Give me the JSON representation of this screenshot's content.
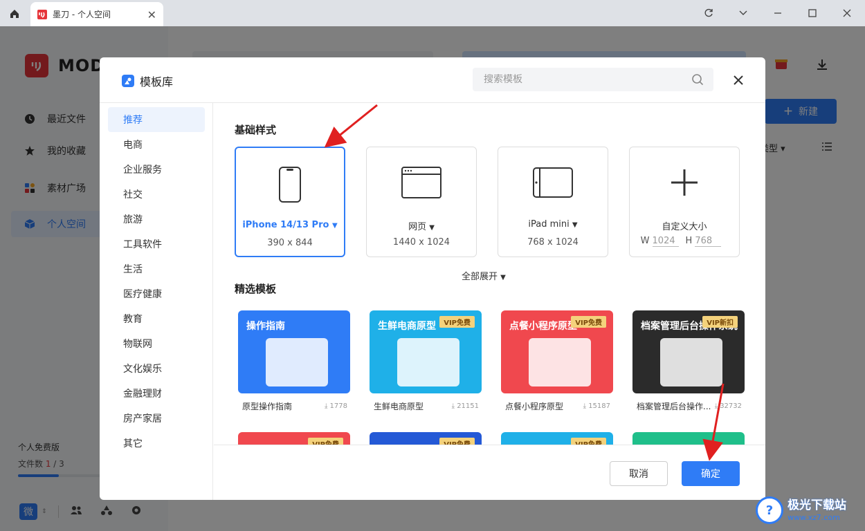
{
  "browser": {
    "tab_title": "墨刀 - 个人空间",
    "tab_close": "✕"
  },
  "sidebar": {
    "logo_text": "MOD",
    "items": [
      {
        "label": "最近文件",
        "icon": "clock-icon"
      },
      {
        "label": "我的收藏",
        "icon": "star-icon"
      },
      {
        "label": "素材广场",
        "icon": "shapes-icon"
      },
      {
        "label": "个人空间",
        "icon": "cube-icon"
      }
    ],
    "plan_label": "个人免费版",
    "file_count_label": "文件数",
    "file_count_value": "1",
    "file_count_total": " / 3",
    "file_usage_fraction": 0.33,
    "account_short": "微"
  },
  "main": {
    "new_button": "新建",
    "sort_label": "类型"
  },
  "modal": {
    "title": "模板库",
    "search_placeholder": "搜索模板",
    "categories": [
      "推荐",
      "电商",
      "企业服务",
      "社交",
      "旅游",
      "工具软件",
      "生活",
      "医疗健康",
      "教育",
      "物联网",
      "文化娱乐",
      "金融理财",
      "房产家居",
      "其它"
    ],
    "active_category": "推荐",
    "basic_title": "基础样式",
    "devices": [
      {
        "name": "iPhone 14/13 Pro",
        "size": "390 x 844",
        "icon": "phone-icon",
        "selected": true
      },
      {
        "name": "网页",
        "size": "1440 x 1024",
        "icon": "browser-window-icon",
        "selected": false
      },
      {
        "name": "iPad mini",
        "size": "768 x 1024",
        "icon": "tablet-icon",
        "selected": false
      }
    ],
    "custom": {
      "name": "自定义大小",
      "w_label": "W",
      "w_value": "1024",
      "h_label": "H",
      "h_value": "768"
    },
    "expand_all": "全部展开",
    "featured_title": "精选模板",
    "templates": [
      {
        "name": "原型操作指南",
        "downloads": "1778",
        "thumb_title": "操作指南",
        "vip": "",
        "color": "#2f7cf6"
      },
      {
        "name": "生鲜电商原型",
        "downloads": "21151",
        "thumb_title": "生鲜电商原型",
        "vip": "VIP免费",
        "color": "#1fb0e8"
      },
      {
        "name": "点餐小程序原型",
        "downloads": "15187",
        "thumb_title": "点餐小程序原型",
        "vip": "VIP免费",
        "color": "#f0484e"
      },
      {
        "name": "档案管理后台操作...",
        "downloads": "32732",
        "thumb_title": "档案管理后台操作系统",
        "vip": "VIP新扣",
        "color": "#2b2b2b"
      }
    ],
    "row2_vip": [
      "VIP免费",
      "VIP免费",
      "VIP免费",
      ""
    ],
    "cancel": "取消",
    "confirm": "确定"
  },
  "watermark": {
    "line1": "极光下载站",
    "line2": "www.xz7.com"
  }
}
